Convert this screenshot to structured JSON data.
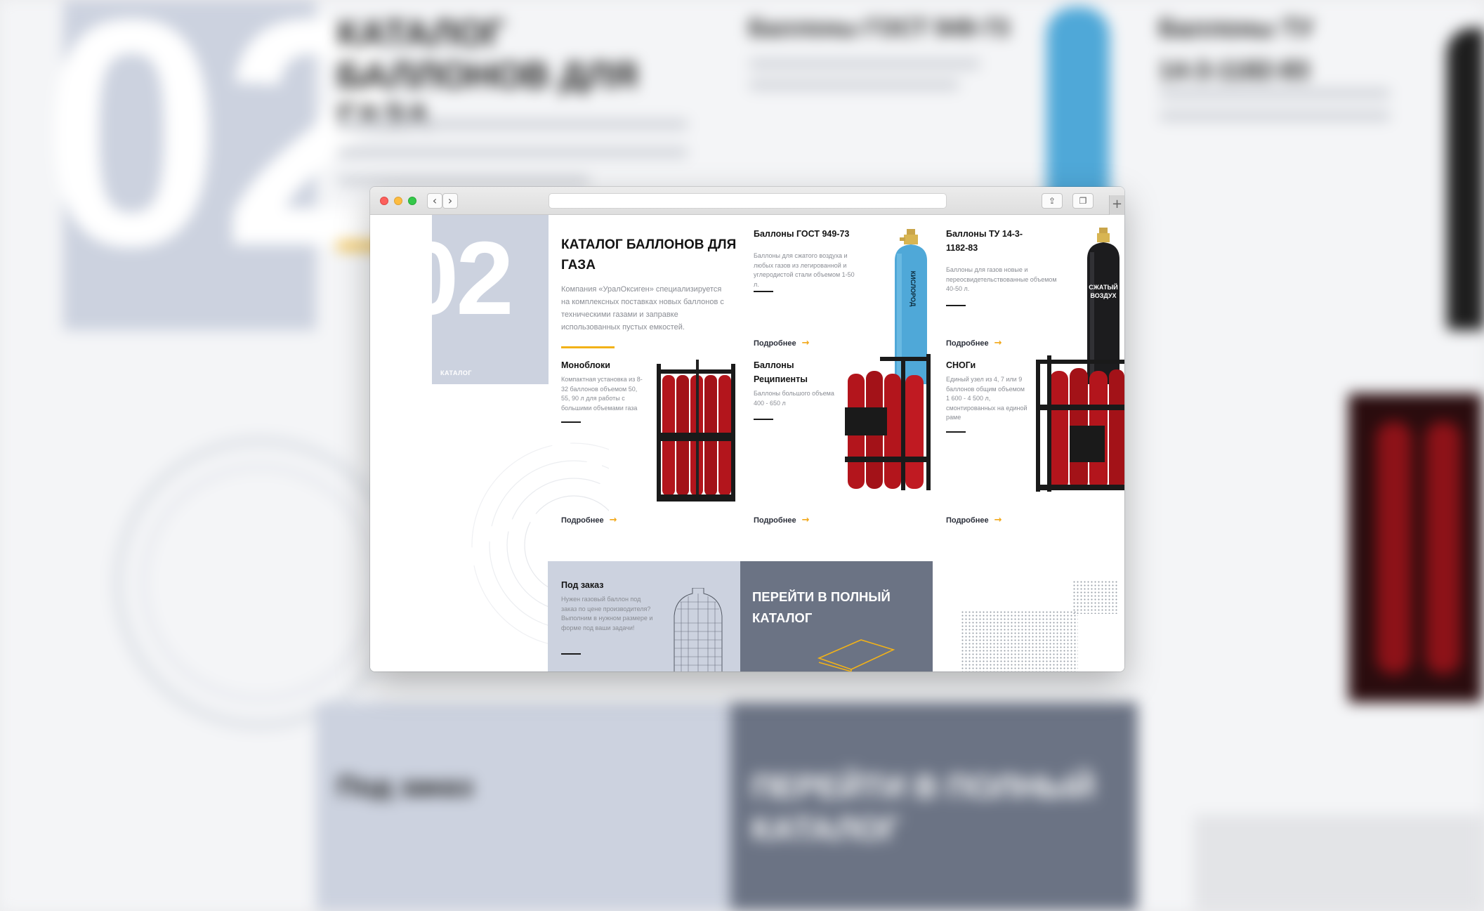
{
  "browser": {
    "address": "",
    "back_glyph": "‹",
    "forward_glyph": "›",
    "share_glyph": "⇪",
    "tabs_glyph": "❐",
    "new_tab_glyph": "+"
  },
  "hero": {
    "number": "02",
    "tag": "КАТАЛОГ",
    "title": "КАТАЛОГ БАЛЛОНОВ ДЛЯ ГАЗА",
    "description": "Компания «УралОксиген» специализируется на комплексных поставках новых баллонов с техническими газами и заправке использованных пустых емкостей."
  },
  "more_label": "Подробнее",
  "more_arrow": "→",
  "cards": {
    "gost": {
      "title": "Баллоны ГОСТ 949-73",
      "description": "Баллоны для сжатого воздуха и любых газов из легированной и углеродистой стали объемом 1-50 л.",
      "cylinder_label": "КИСЛОРОД"
    },
    "tu": {
      "title": "Баллоны ТУ 14-3-1182-83",
      "description": "Баллоны для газов новые и переосвидетельствованные объемом 40-50 л.",
      "cylinder_label_1": "СЖАТЫЙ",
      "cylinder_label_2": "ВОЗДУХ"
    },
    "monoblocks": {
      "title": "Моноблоки",
      "description": "Компактная установка из 8-32 баллонов объемом 50, 55, 90 л для работы с большими объемами газа"
    },
    "recipients": {
      "title": "Баллоны Реципиенты",
      "description": "Баллоны большого объема 400 - 650 л"
    },
    "snog": {
      "title": "СНОГи",
      "description": "Единый узел из 4, 7 или 9 баллонов общим объемом 1 600 - 4 500 л, смонтированных на единой раме"
    },
    "order": {
      "title": "Под заказ",
      "description": "Нужен газовый баллон под заказ по цене производителя? Выполним в нужном размере и форме под ваши задачи!"
    }
  },
  "goto_catalog": "ПЕРЕЙТИ В ПОЛНЫЙ КАТАЛОГ",
  "colors": {
    "accent": "#f2b218",
    "hero_block": "#ccd2df",
    "catalog_block": "#6b7384",
    "oxygen_cylinder": "#4fa8d8",
    "red_cylinder": "#b3151c"
  }
}
